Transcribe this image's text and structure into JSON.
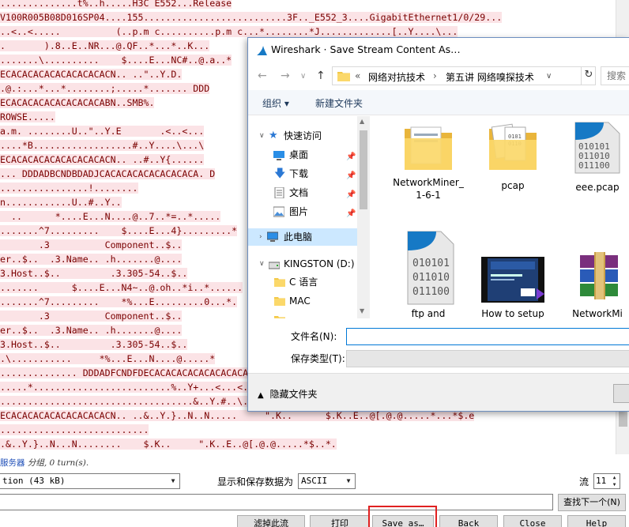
{
  "stream": {
    "lines": [
      "..............t%..h.....H3C E552...Release",
      "V100R005B08D016SP04....155..........................3F.._E552_3....GigabitEthernet1/0/29...",
      "..<..<.....          (..p.m c..........p.m c...*........*J.............[..Y....\\...",
      ".       ).8..E..NR...@.QF..*...*..K...",
      ".......\\..........    $....E...NC#..@.a..*",
      "ECACACACACACACACACACN.. ..\"..Y.D.",
      ".@.:...*...*........;.....*....... DDD",
      "ECACACACACACACACACABN..SMB%.",
      "ROWSE.....",
      "a.m. ........U..\"..Y.E       .<..<...",
      "....*B..................#..Y....\\...\\",
      "ECACACACACACACACACACN.. ..#..Y{......",
      "... DDDADBCNDBDADJCACACACACACACACACA. D",
      "................!........",
      "n............U..#..Y..",
      "  ..      *....E...N....@..7..*=..*.....",
      ".......^7.........    $....E...4}.........*",
      "       .3          Component..$..",
      "er..$..  .3.Name.. .h.......@....",
      "3.Host..$..         .3.305-54..$..",
      ".......      $....E...N4~..@.oh..*i..*......",
      ".......^7.........    *%...E.........0...*.",
      "       .3          Component..$..",
      "er..$..  .3.Name.. .h.......@....",
      "3.Host..$..         .3.305-54..$..",
      ".\\...........     *%...E...N....@.....*",
      ".............. DDDADFCNDFDECACACACACACACACACA",
      ".....*.........................%..Y+...<...<..",
      "...................................&..Y.#..\\...\\......",
      "ECACACACACACACACACACN.. ..&..Y.}..N..N.....     \".K..      $.K..E..@[.@.@.....*...*$.e",
      "...........................",
      ".&..Y.}..N...N........    $.K..     \".K..E..@[.@.@.....*$..*."
    ],
    "status_prefix": "服务器",
    "status_suffix": " 分组, 0 turn(s).",
    "conversation_value": "tion (43 kB)",
    "show_save_label": "显示和保存数据为",
    "encoding_value": "ASCII",
    "stream_label": "流",
    "stream_number": "11",
    "find_next_label": "查找下一个(N)",
    "buttons": {
      "filter_out": "滤掉此流",
      "print": "打印",
      "save_as": "Save as…",
      "back": "Back",
      "close": "Close",
      "help": "Help"
    }
  },
  "dialog": {
    "title": "Wireshark · Save Stream Content As…",
    "breadcrumb_prefix": "«",
    "breadcrumb": [
      "网络对抗技术",
      "第五讲 网络嗅探技术"
    ],
    "search_placeholder": "搜索",
    "organize": "组织 ▾",
    "new_folder": "新建文件夹",
    "nav": {
      "quick_access": "快速访问",
      "desktop": "桌面",
      "downloads": "下载",
      "documents": "文档",
      "pictures": "图片",
      "this_pc": "此电脑",
      "kingston": "KINGSTON (D:)",
      "c_lang": "C 语言",
      "mac": "MAC"
    },
    "files": [
      {
        "label": "NetworkMiner_\n1-6-1",
        "icon": "folder-icon"
      },
      {
        "label": "pcap",
        "icon": "folder-icon"
      },
      {
        "label": "eee.pcap",
        "icon": "binary-file-icon"
      },
      {
        "label": "ftp and",
        "icon": "binary-file-icon"
      },
      {
        "label": "How to setup",
        "icon": "video-file-icon"
      },
      {
        "label": "NetworkMi",
        "icon": "winrar-archive-icon"
      }
    ],
    "filename_label": "文件名(N):",
    "filename_value": "",
    "type_label": "保存类型(T):",
    "type_value": "",
    "hide_folders": "隐藏文件夹",
    "binary_text": "010101\n011010\n011100"
  },
  "colors": {
    "stream_text": "#7a0000",
    "stream_highlight": "#fbe3e6",
    "accent": "#0078d7",
    "highlight_box": "#e02020"
  }
}
